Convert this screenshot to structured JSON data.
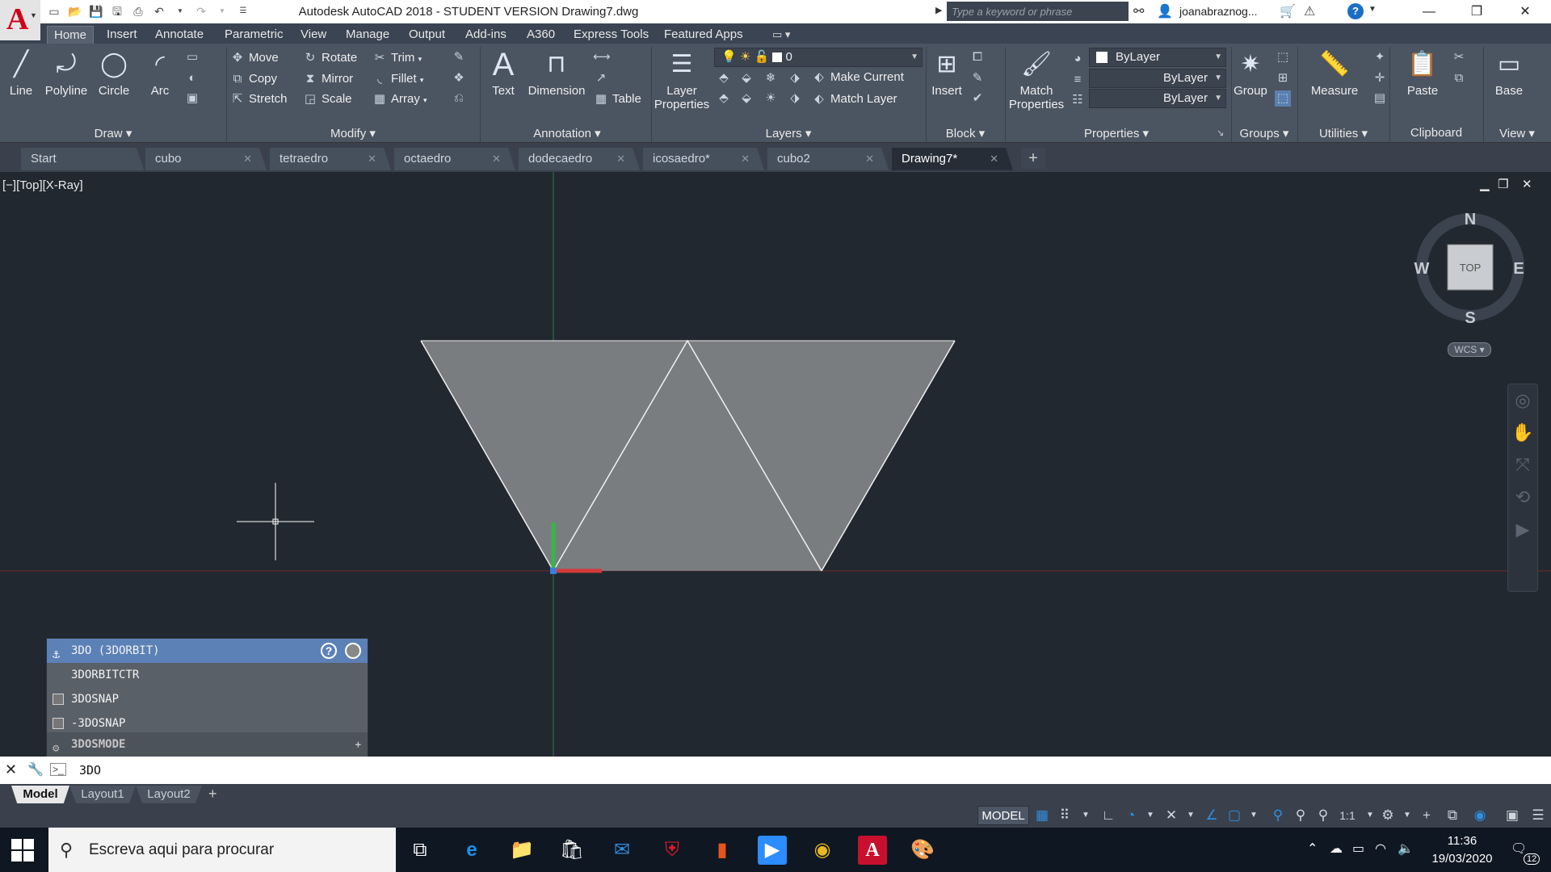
{
  "window": {
    "title": "Autodesk AutoCAD 2018 - STUDENT VERSION    Drawing7.dwg",
    "search_placeholder": "Type a keyword or phrase",
    "user": "joanabraznog...",
    "minimize": "—",
    "restore": "❐",
    "close": "✕"
  },
  "ribbon_tabs": [
    "Home",
    "Insert",
    "Annotate",
    "Parametric",
    "View",
    "Manage",
    "Output",
    "Add-ins",
    "A360",
    "Express Tools",
    "Featured Apps"
  ],
  "ribbon": {
    "draw": {
      "title": "Draw",
      "line": "Line",
      "polyline": "Polyline",
      "circle": "Circle",
      "arc": "Arc"
    },
    "modify": {
      "title": "Modify",
      "move": "Move",
      "copy": "Copy",
      "stretch": "Stretch",
      "rotate": "Rotate",
      "mirror": "Mirror",
      "scale": "Scale",
      "trim": "Trim",
      "fillet": "Fillet",
      "array": "Array"
    },
    "annotation": {
      "title": "Annotation",
      "text": "Text",
      "dimension": "Dimension",
      "table": "Table"
    },
    "layers": {
      "title": "Layers",
      "layer_properties_1": "Layer",
      "layer_properties_2": "Properties",
      "current_layer": "0",
      "make_current": "Make Current",
      "match_layer": "Match Layer"
    },
    "block": {
      "title": "Block",
      "insert": "Insert"
    },
    "properties": {
      "title": "Properties",
      "match_1": "Match",
      "match_2": "Properties",
      "color": "ByLayer",
      "linetype": "ByLayer",
      "lineweight": "ByLayer"
    },
    "groups": {
      "title": "Groups",
      "group": "Group"
    },
    "utilities": {
      "title": "Utilities",
      "measure": "Measure"
    },
    "clipboard": {
      "title": "Clipboard",
      "paste": "Paste"
    },
    "view": {
      "title": "View",
      "base": "Base"
    }
  },
  "doc_tabs": [
    "Start",
    "cubo",
    "tetraedro",
    "octaedro",
    "dodecaedro",
    "icosaedro*",
    "cubo2",
    "Drawing7*"
  ],
  "viewport": {
    "label": "[−][Top][X-Ray]",
    "viewcube": {
      "n": "N",
      "s": "S",
      "e": "E",
      "w": "W",
      "face": "TOP",
      "wcs": "WCS"
    },
    "drawing_color": "#7a7d80",
    "x_axis_color": "#c0392b",
    "y_axis_color": "#2e9a3a"
  },
  "autocomplete": {
    "items": [
      "3DO (3DORBIT)",
      "3DORBITCTR",
      "3DOSNAP",
      "-3DOSNAP"
    ],
    "group": "3DOSMODE",
    "help": "?"
  },
  "command_line": {
    "input": "3DO"
  },
  "layout_tabs": [
    "Model",
    "Layout1",
    "Layout2"
  ],
  "status": {
    "model": "MODEL",
    "scale": "1:1"
  },
  "taskbar": {
    "search_placeholder": "Escreva aqui para procurar",
    "time": "11:36",
    "date": "19/03/2020",
    "notifications": "12"
  }
}
